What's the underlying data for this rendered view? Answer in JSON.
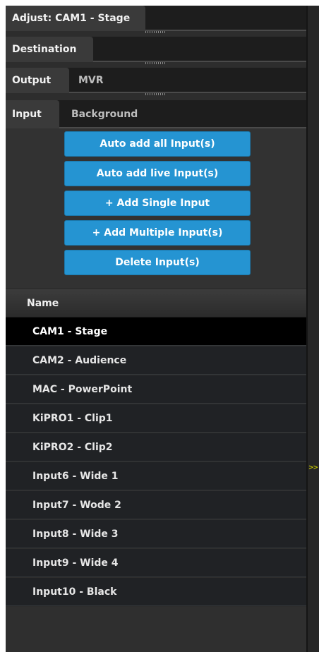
{
  "tabs": {
    "adjust": "Adjust: CAM1 - Stage",
    "destination": "Destination",
    "output": "Output",
    "mvr": "MVR",
    "input": "Input",
    "background": "Background"
  },
  "actions": {
    "auto_add_all": "Auto add all Input(s)",
    "auto_add_live": "Auto add live Input(s)",
    "add_single": "+ Add Single Input",
    "add_multiple": "+ Add Multiple Input(s)",
    "delete": "Delete Input(s)"
  },
  "list": {
    "header": "Name",
    "selected_index": 0,
    "rows": [
      "CAM1 - Stage",
      "CAM2 - Audience",
      "MAC - PowerPoint",
      "KiPRO1 - Clip1",
      "KiPRO2 - Clip2",
      "Input6 - Wide 1",
      "Input7 - Wode 2",
      "Input8 - Wide 3",
      "Input9 - Wide 4",
      "Input10 - Black"
    ]
  },
  "side": {
    "expand_glyph": ">>"
  },
  "colors": {
    "button_blue": "#2594d2",
    "panel_bg": "#2d2d2d",
    "row_bg": "#202225",
    "row_selected": "#000000",
    "arrow_yellow": "#c8c800"
  }
}
